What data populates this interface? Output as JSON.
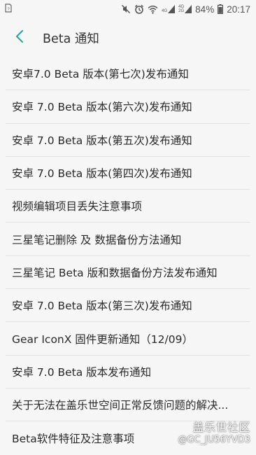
{
  "status_bar": {
    "left_icon": "sim-card-icon",
    "icons": [
      "mute-icon",
      "alarm-icon",
      "wifi-icon",
      "signal-4g-icon",
      "signal-4g-2g-icon"
    ],
    "signal_label_top": "4G",
    "signal_label_bottom": "2G",
    "battery_percent": "84%",
    "time": "20:17"
  },
  "header": {
    "back_icon": "back-arrow-icon",
    "title": "Beta 通知",
    "accent_color": "#2aa7a0"
  },
  "list": {
    "items": [
      {
        "label": "安卓7.0 Beta 版本(第七次)发布通知"
      },
      {
        "label": "安卓 7.0 Beta 版本(第六次)发布通知"
      },
      {
        "label": "安卓 7.0 Beta 版本(第五次)发布通知"
      },
      {
        "label": "安卓 7.0 Beta 版本(第四次)发布通知"
      },
      {
        "label": "视频编辑项目丢失注意事项"
      },
      {
        "label": "三星笔记删除 及 数据备份方法通知"
      },
      {
        "label": "三星笔记 Beta 版和数据备份方法发布通知"
      },
      {
        "label": "安卓 7.0 Beta 版本(第三次)发布通知"
      },
      {
        "label": "Gear IconX 固件更新通知（12/09）"
      },
      {
        "label": "安卓 7.0 Beta 版本发布通知"
      },
      {
        "label": "关于无法在盖乐世空间正常反馈问题的解决..."
      },
      {
        "label": "Beta软件特征及注意事项"
      }
    ]
  },
  "watermark": {
    "brand": "盖乐世社区",
    "handle": "@GC_JU56YVD3"
  }
}
